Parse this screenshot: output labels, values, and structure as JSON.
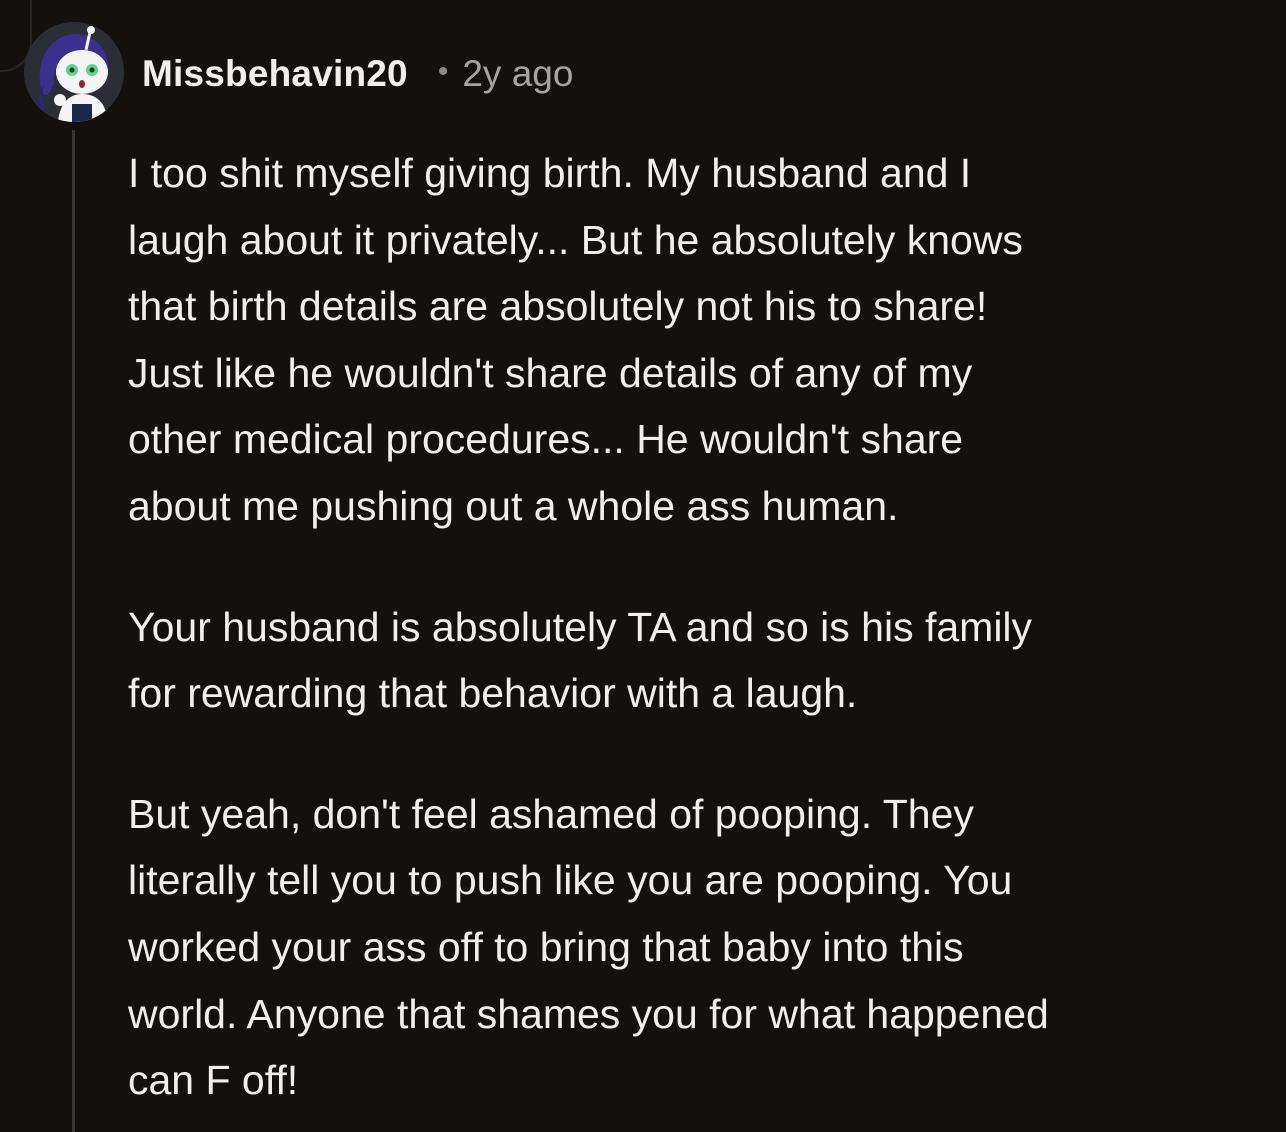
{
  "comment": {
    "author": "Missbehavin20",
    "separator": "•",
    "time_ago": "2y ago",
    "avatar_icon": "snoo-avatar-icon",
    "paragraphs": [
      "I too shit myself giving birth. My husband and I\nlaugh about it privately... But he absolutely knows\nthat birth details are absolutely not his to share!\nJust like he wouldn't share details of any of my\nother medical procedures... He wouldn't share\nabout me pushing out a whole ass human.",
      "Your husband is absolutely TA and so is his family\nfor rewarding that behavior with a laugh.",
      "But yeah, don't feel ashamed of pooping. They\nliterally tell you to push like you are pooping. You\nworked your ass off to bring that baby into this\nworld. Anyone that shames you for what happened\ncan F off!"
    ]
  },
  "colors": {
    "background": "#14100e",
    "text": "#f2eeeb",
    "meta": "#a8a39f",
    "thread_line": "#3a3532"
  }
}
